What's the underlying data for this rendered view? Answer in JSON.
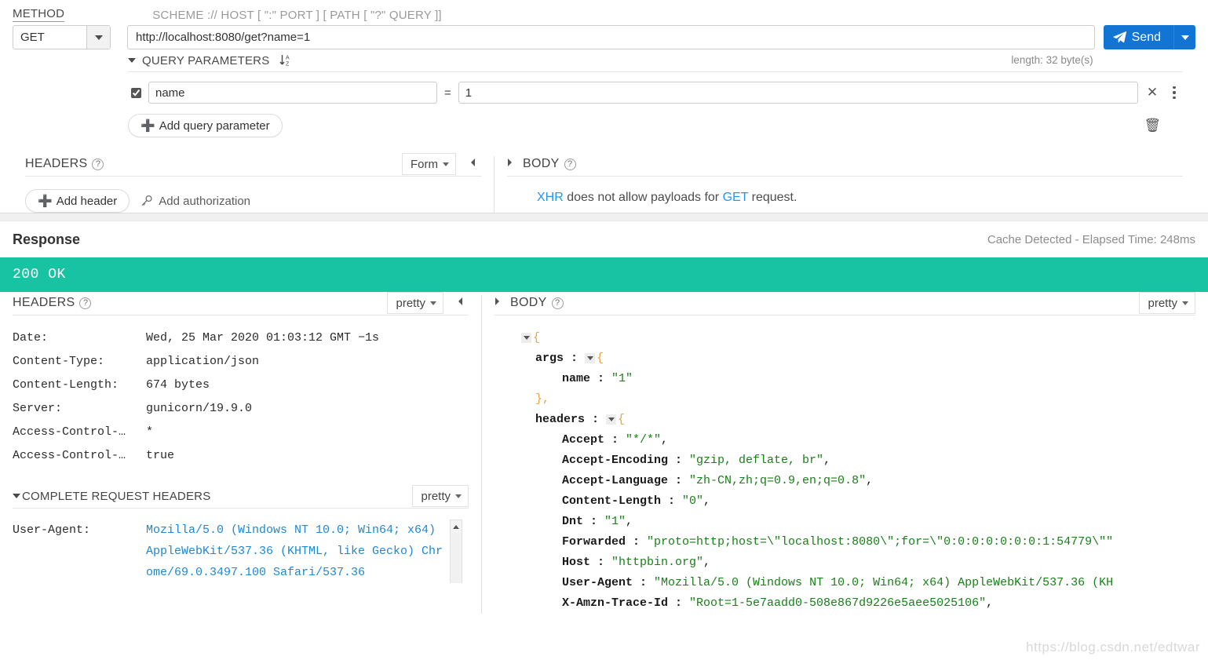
{
  "request": {
    "method_label": "METHOD",
    "url_label": "SCHEME :// HOST [ \":\" PORT ] [ PATH [ \"?\" QUERY ]]",
    "method_value": "GET",
    "url_value": "http://localhost:8080/get?name=1",
    "length_note": "length: 32 byte(s)",
    "send_label": "Send",
    "query_params": {
      "title": "QUERY PARAMETERS",
      "sort_icon": "sort-az-icon",
      "rows": [
        {
          "enabled": true,
          "name": "name",
          "eq": "=",
          "value": "1"
        }
      ],
      "add_label": "Add query parameter",
      "remove_icon": "close-icon",
      "menu_icon": "kebab-menu-icon",
      "trash_icon": "trash-icon"
    },
    "headers_panel": {
      "title": "HEADERS",
      "mode": "Form",
      "add_header_label": "Add header",
      "add_auth_label": "Add authorization"
    },
    "body_panel": {
      "title": "BODY",
      "message_prefix": "XHR",
      "message_middle": " does not allow payloads for ",
      "message_method": "GET",
      "message_suffix": " request."
    }
  },
  "response": {
    "title": "Response",
    "meta": "Cache Detected - Elapsed Time: 248ms",
    "status": "200 OK",
    "status_color": "#17c3a2",
    "headers_panel": {
      "title": "HEADERS",
      "mode": "pretty",
      "rows": [
        {
          "key": "Date:",
          "value": "Wed, 25 Mar 2020 01:03:12 GMT −1s"
        },
        {
          "key": "Content-Type:",
          "value": "application/json"
        },
        {
          "key": "Content-Length:",
          "value": "674 bytes"
        },
        {
          "key": "Server:",
          "value": "gunicorn/19.9.0"
        },
        {
          "key": "Access-Control-…",
          "value": "*"
        },
        {
          "key": "Access-Control-…",
          "value": "true"
        }
      ]
    },
    "complete_request_headers": {
      "title": "COMPLETE REQUEST HEADERS",
      "mode": "pretty",
      "user_agent_key": "User-Agent:",
      "user_agent_value": "Mozilla/5.0 (Windows NT 10.0; Win64; x64) AppleWebKit/537.36 (KHTML, like Gecko) Chrome/69.0.3497.100 Safari/537.36"
    },
    "body_panel": {
      "title": "BODY",
      "mode": "pretty",
      "json_lines": [
        {
          "indent": 0,
          "toggle": true,
          "text": "",
          "brace": "{"
        },
        {
          "indent": 1,
          "toggle": true,
          "key": "args",
          "brace": "{"
        },
        {
          "indent": 2,
          "key": "name",
          "value": "\"1\""
        },
        {
          "indent": 1,
          "close": "},"
        },
        {
          "indent": 1,
          "toggle": true,
          "key": "headers",
          "brace": "{"
        },
        {
          "indent": 2,
          "key": "Accept",
          "value": "\"*/*\"",
          "comma": ","
        },
        {
          "indent": 2,
          "key": "Accept-Encoding",
          "value": "\"gzip, deflate, br\"",
          "comma": ","
        },
        {
          "indent": 2,
          "key": "Accept-Language",
          "value": "\"zh-CN,zh;q=0.9,en;q=0.8\"",
          "comma": ","
        },
        {
          "indent": 2,
          "key": "Content-Length",
          "value": "\"0\"",
          "comma": ","
        },
        {
          "indent": 2,
          "key": "Dnt",
          "value": "\"1\"",
          "comma": ","
        },
        {
          "indent": 2,
          "key": "Forwarded",
          "value": "\"proto=http;host=\\\"localhost:8080\\\";for=\\\"0:0:0:0:0:0:0:1:54779\\\"\""
        },
        {
          "indent": 2,
          "key": "Host",
          "value": "\"httpbin.org\"",
          "comma": ","
        },
        {
          "indent": 2,
          "key": "User-Agent",
          "value": "\"Mozilla/5.0 (Windows NT 10.0; Win64; x64) AppleWebKit/537.36 (KH"
        },
        {
          "indent": 2,
          "key": "X-Amzn-Trace-Id",
          "value": "\"Root=1-5e7aadd0-508e867d9226e5aee5025106\"",
          "comma": ","
        }
      ]
    }
  },
  "watermark": "https://blog.csdn.net/edtwar"
}
